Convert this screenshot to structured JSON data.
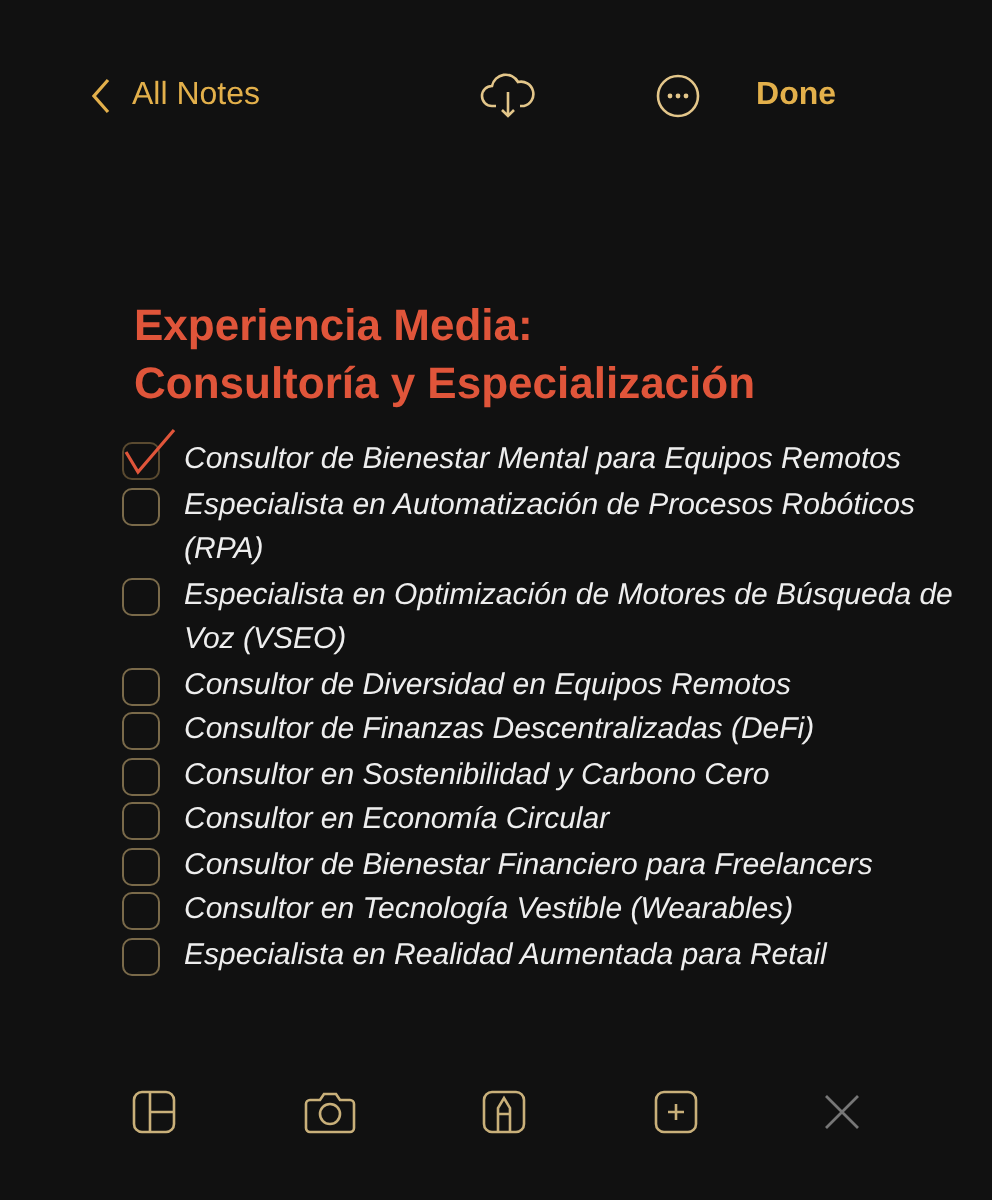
{
  "nav": {
    "back": "All Notes",
    "done": "Done"
  },
  "title_lines": [
    "Experiencia Media:",
    "Consultoría y Especialización"
  ],
  "items": [
    {
      "text": "Consultor de Bienestar Mental para Equipos Remotos",
      "checked": true
    },
    {
      "text": "Especialista en Automatización de Procesos Robóticos (RPA)",
      "checked": false
    },
    {
      "text": "Especialista en Optimización de Motores de Búsqueda de Voz (VSEO)",
      "checked": false
    },
    {
      "text": "Consultor de Diversidad en Equipos Remotos",
      "checked": false
    },
    {
      "text": "Consultor de Finanzas Descentralizadas (DeFi)",
      "checked": false
    },
    {
      "text": "Consultor en Sostenibilidad y Carbono Cero",
      "checked": false
    },
    {
      "text": "Consultor en Economía Circular",
      "checked": false
    },
    {
      "text": "Consultor de Bienestar Financiero para Freelancers",
      "checked": false
    },
    {
      "text": "Consultor en Tecnología Vestible (Wearables)",
      "checked": false
    },
    {
      "text": "Especialista en Realidad Aumentada para Retail",
      "checked": false
    }
  ]
}
